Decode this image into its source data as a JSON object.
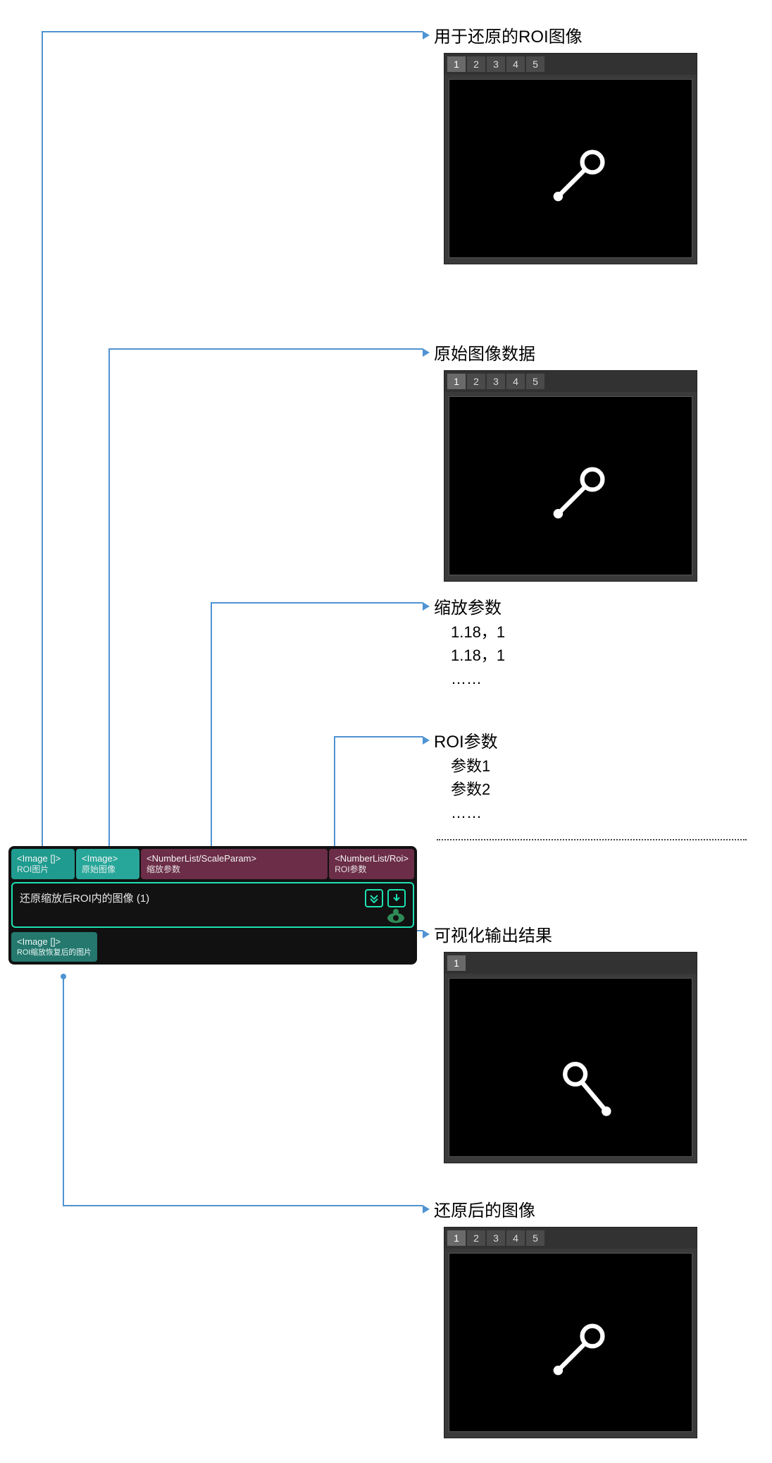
{
  "annotations": {
    "roi_image": {
      "title": "用于还原的ROI图像"
    },
    "orig_image": {
      "title": "原始图像数据"
    },
    "scale_params": {
      "title": "缩放参数",
      "lines": [
        "1.18，1",
        "1.18，1",
        "……"
      ]
    },
    "roi_params": {
      "title": "ROI参数",
      "lines": [
        "参数1",
        "参数2",
        "……"
      ]
    },
    "vis_output": {
      "title": "可视化输出结果"
    },
    "restored": {
      "title": "还原后的图像"
    }
  },
  "node": {
    "title": "还原缩放后ROI内的图像 (1)",
    "ports_in": [
      {
        "type": "<Image []>",
        "label": "ROI图片",
        "cls": "teal"
      },
      {
        "type": "<Image>",
        "label": "原始图像",
        "cls": "teal2"
      },
      {
        "type": "<NumberList/ScaleParam>",
        "label": "缩放参数",
        "cls": "maroon"
      },
      {
        "type": "<NumberList/Roi>",
        "label": "ROI参数",
        "cls": "maroon"
      }
    ],
    "port_out": {
      "type": "<Image []>",
      "label": "ROI缩放恢复后的图片"
    }
  },
  "tabs5": [
    "1",
    "2",
    "3",
    "4",
    "5"
  ],
  "tabs1": [
    "1"
  ]
}
